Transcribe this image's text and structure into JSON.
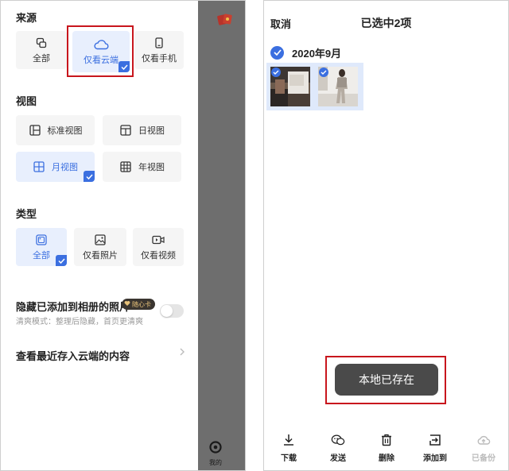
{
  "left": {
    "source": {
      "title": "来源",
      "options": [
        {
          "label": "全部",
          "icon": "all-icon",
          "selected": false
        },
        {
          "label": "仅看云端",
          "icon": "cloud-icon",
          "selected": true
        },
        {
          "label": "仅看手机",
          "icon": "phone-icon",
          "selected": false
        }
      ]
    },
    "view": {
      "title": "视图",
      "options": [
        {
          "label": "标准视图",
          "icon": "standard-view-icon",
          "selected": false
        },
        {
          "label": "日视图",
          "icon": "day-view-icon",
          "selected": false
        },
        {
          "label": "月视图",
          "icon": "month-view-icon",
          "selected": true
        },
        {
          "label": "年视图",
          "icon": "year-view-icon",
          "selected": false
        }
      ]
    },
    "type": {
      "title": "类型",
      "options": [
        {
          "label": "全部",
          "icon": "media-all-icon",
          "selected": true
        },
        {
          "label": "仅看照片",
          "icon": "photo-icon",
          "selected": false
        },
        {
          "label": "仅看视频",
          "icon": "video-icon",
          "selected": false
        }
      ]
    },
    "hide_added": {
      "label": "隐藏已添加到相册的照片",
      "badge": "随心卡",
      "description": "清爽模式：整理后隐藏，首页更清爽",
      "enabled": false
    },
    "recent_link": "查看最近存入云端的内容",
    "side_nav_label": "我的"
  },
  "right": {
    "cancel": "取消",
    "title": "已选中2项",
    "date_group": "2020年9月",
    "toast": "本地已存在",
    "toolbar": [
      {
        "label": "下载",
        "icon": "download-icon",
        "disabled": false
      },
      {
        "label": "发送",
        "icon": "send-icon",
        "disabled": false
      },
      {
        "label": "删除",
        "icon": "delete-icon",
        "disabled": false
      },
      {
        "label": "添加到",
        "icon": "add-to-icon",
        "disabled": false
      },
      {
        "label": "已备份",
        "icon": "backed-up-icon",
        "disabled": true
      }
    ]
  },
  "colors": {
    "accent": "#3b6fe0",
    "highlight": "#c8161d",
    "toast": "#4a4a4a"
  }
}
